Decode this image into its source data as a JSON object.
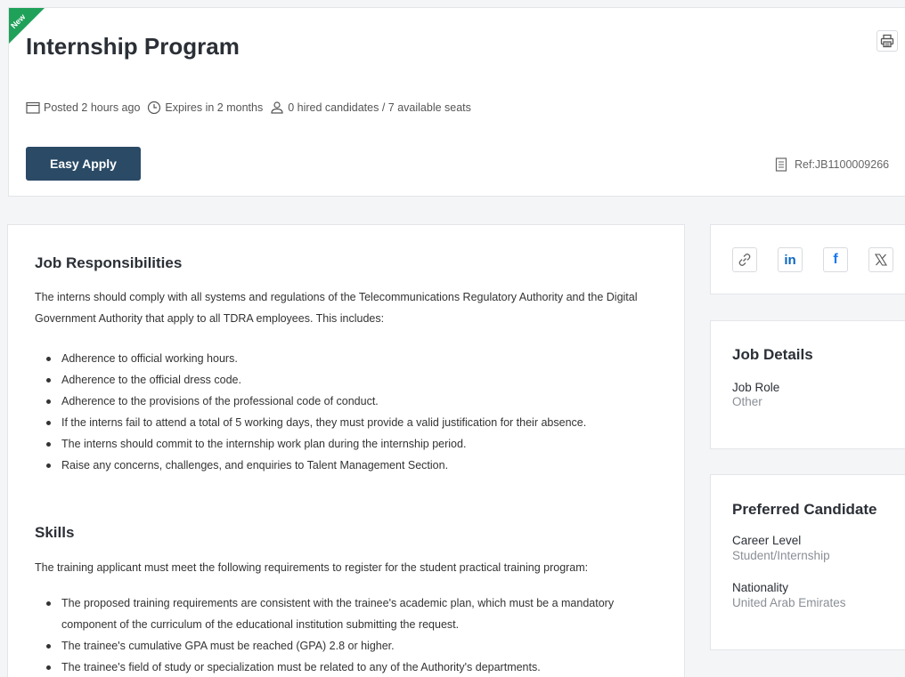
{
  "header": {
    "ribbon": "New",
    "title": "Internship Program",
    "meta": {
      "posted": "Posted 2 hours ago",
      "expires": "Expires in 2 months",
      "hired": "0 hired candidates / 7 available seats"
    },
    "apply_label": "Easy Apply",
    "ref": "Ref:JB1100009266"
  },
  "responsibilities": {
    "title": "Job Responsibilities",
    "intro": "The interns should comply with all systems and regulations of the Telecommunications Regulatory Authority and the Digital Government Authority that apply to all TDRA employees. This includes:",
    "items": [
      "Adherence to official working hours.",
      "Adherence to the official dress code.",
      "Adherence to the provisions of the professional code of conduct.",
      "If the interns fail to attend a total of 5 working days, they must provide a valid justification for their absence.",
      "The interns should commit to the internship work plan during the internship period.",
      "Raise any concerns, challenges, and enquiries to Talent Management Section."
    ]
  },
  "skills": {
    "title": "Skills",
    "intro": "The training applicant must meet the following requirements to register for the student practical training program:",
    "items": [
      "The proposed training requirements are consistent with the trainee's academic plan, which must be a mandatory component of the curriculum of the educational institution submitting the request.",
      "The trainee's cumulative GPA must be reached (GPA) 2.8 or higher.",
      "The trainee's field of study or specialization must be related to any of the Authority's departments."
    ]
  },
  "share": {
    "icons": [
      "link-icon",
      "linkedin-icon",
      "facebook-icon",
      "x-icon"
    ],
    "linkedin_text": "in",
    "facebook_text": "f"
  },
  "job_details": {
    "title": "Job Details",
    "role_label": "Job Role",
    "role_value": "Other"
  },
  "preferred": {
    "title": "Preferred Candidate",
    "career_label": "Career Level",
    "career_value": "Student/Internship",
    "nationality_label": "Nationality",
    "nationality_value": "United Arab Emirates"
  },
  "colors": {
    "primary_button": "#2a4a66",
    "ribbon": "#1fa15a",
    "linkedin": "#0a66c2",
    "facebook": "#1877f2"
  }
}
